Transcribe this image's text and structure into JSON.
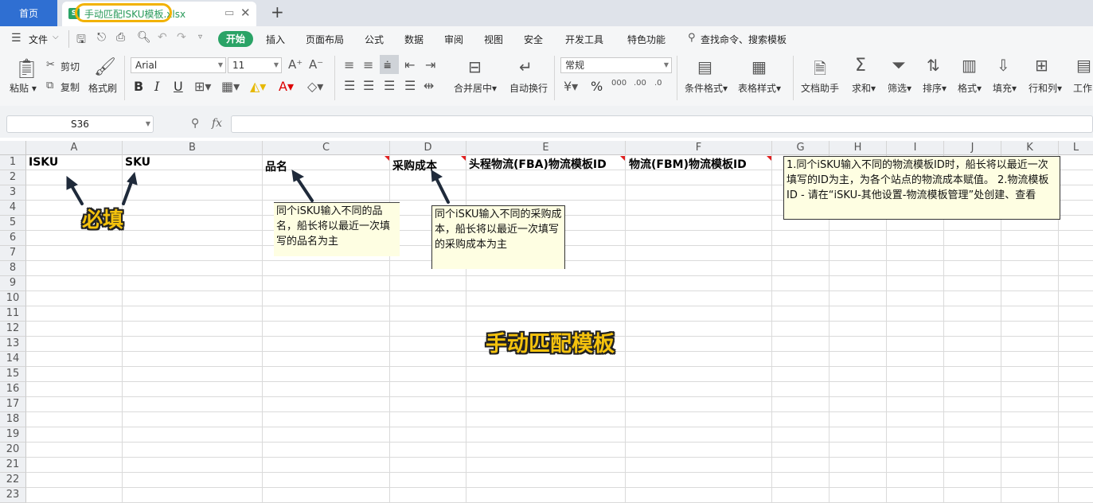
{
  "tabs": {
    "home": "首页",
    "file": "手动匹配ISKU模板.xlsx",
    "file_icon": "S"
  },
  "menu": {
    "file": "文件",
    "items": [
      "开始",
      "插入",
      "页面布局",
      "公式",
      "数据",
      "审阅",
      "视图",
      "安全",
      "开发工具",
      "特色功能"
    ],
    "search": "查找命令、搜索模板"
  },
  "ribbon": {
    "paste": "粘贴",
    "cut": "剪切",
    "copy": "复制",
    "format_painter": "格式刷",
    "font_name": "Arial",
    "font_size": "11",
    "bold": "B",
    "italic": "I",
    "underline": "U",
    "merge": "合并居中",
    "wrap": "自动换行",
    "number_format": "常规",
    "percent": "%",
    "cond_format": "条件格式",
    "table_style": "表格样式",
    "doc_helper": "文档助手",
    "sum": "求和",
    "filter": "筛选",
    "sort": "排序",
    "format": "格式",
    "fill": "填充",
    "rowcol": "行和列",
    "worksheet": "工作"
  },
  "formula_bar": {
    "name_box": "S36",
    "fx": "fx",
    "value": ""
  },
  "sheet": {
    "columns": [
      "A",
      "B",
      "C",
      "D",
      "E",
      "F",
      "G",
      "H",
      "I",
      "J",
      "K",
      "L"
    ],
    "rows": [
      "1",
      "2",
      "3",
      "4",
      "5",
      "6",
      "7",
      "8",
      "9",
      "10",
      "11",
      "12",
      "13",
      "14",
      "15",
      "16",
      "17",
      "18",
      "19",
      "20",
      "21",
      "22",
      "23"
    ],
    "headers": {
      "A1": "ISKU",
      "B1": "SKU",
      "C1": "品名",
      "D1": "采购成本",
      "E1": "头程物流(FBA)物流模板ID",
      "F1": "物流(FBM)物流模板ID"
    }
  },
  "notes": {
    "c": "同个iSKU输入不同的品名，船长将以最近一次填写的品名为主",
    "d": "同个iSKU输入不同的采购成本，船长将以最近一次填写的采购成本为主",
    "g": "1.同个iSKU输入不同的物流模板ID时，船长将以最近一次填写的ID为主，为各个站点的物流成本赋值。 2.物流模板ID - 请在“iSKU-其他设置-物流模板管理”处创建、查看"
  },
  "annotations": {
    "required": "必填",
    "title": "手动匹配模板"
  },
  "colors": {
    "accent_green": "#2aa366",
    "home_tab_blue": "#2f6fd2",
    "highlight_yellow": "#f2b200",
    "comment_bg": "#fefee2",
    "overlay_text": "#f4c20d"
  }
}
